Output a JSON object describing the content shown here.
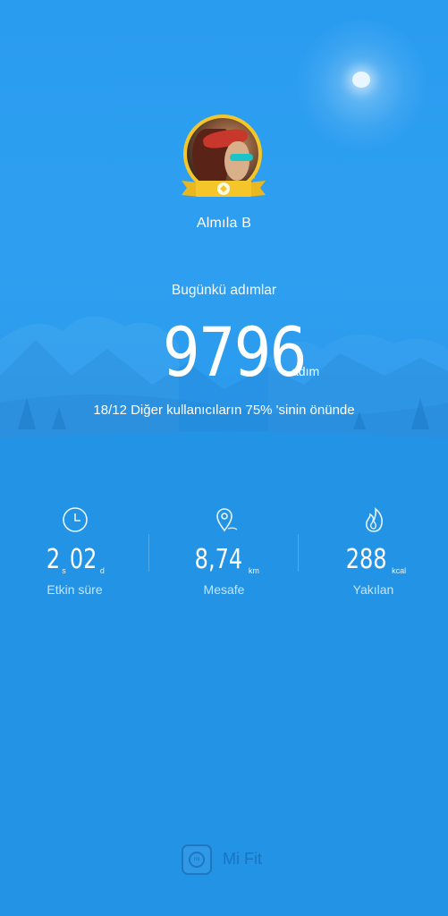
{
  "profile": {
    "name": "Almıla B"
  },
  "today": {
    "label": "Bugünkü adımlar",
    "steps": "9796",
    "unit": "adım",
    "rank_text": "18/12 Diğer kullanıcıların 75% 'sinin önünde"
  },
  "stats": [
    {
      "icon": "clock-icon",
      "value_a": "2",
      "unit_a": "s",
      "value_b": "02",
      "unit_b": "d",
      "label": "Etkin süre"
    },
    {
      "icon": "location-pin-icon",
      "value": "8,74",
      "unit": "km",
      "label": "Mesafe"
    },
    {
      "icon": "flame-icon",
      "value": "288",
      "unit": "kcal",
      "label": "Yakılan"
    }
  ],
  "brand": {
    "logo_text": "mi",
    "name": "Mi Fit"
  },
  "colors": {
    "background": "#2393e6",
    "badge": "#f4c62a"
  }
}
